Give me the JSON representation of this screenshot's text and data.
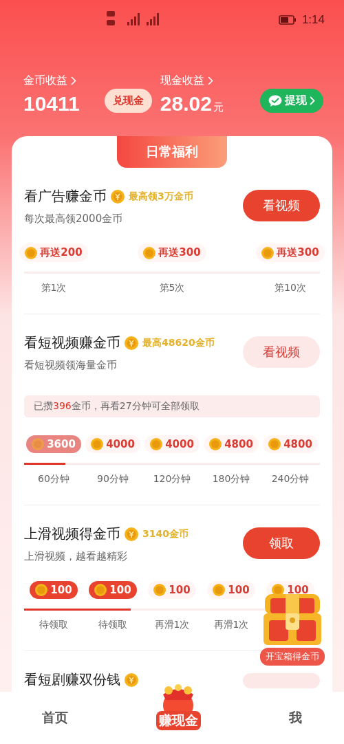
{
  "status_bar": {
    "time": "1:14"
  },
  "earnings": {
    "coins": {
      "label": "金币收益",
      "value": "10411"
    },
    "exchange_button": "兑现金",
    "cash": {
      "label": "现金收益",
      "value": "28.02",
      "unit": "元"
    },
    "withdraw_button": "提现"
  },
  "section_title": "日常福利",
  "tasks": [
    {
      "title": "看广告赚金币",
      "badge": "最高领3万金币",
      "subtitle": "每次最高领2000金币",
      "button": {
        "label": "看视频",
        "kind": "primary"
      },
      "milestones": [
        {
          "amount": "再送200",
          "caption": "第1次",
          "kind": "pending"
        },
        {
          "amount": "再送300",
          "caption": "第5次",
          "kind": "pending"
        },
        {
          "amount": "再送300",
          "caption": "第10次",
          "kind": "pending"
        }
      ]
    },
    {
      "title": "看短视频赚金币",
      "badge": "最高48620金币",
      "subtitle": "看短视频领海量金币",
      "button": {
        "label": "看视频",
        "kind": "soft"
      },
      "notice": {
        "before": "已攒",
        "highlight": "396",
        "after": "金币，再看27分钟可全部领取"
      },
      "level": 0.14,
      "milestones": [
        {
          "amount": "3600",
          "caption": "60分钟",
          "kind": "reached"
        },
        {
          "amount": "4000",
          "caption": "90分钟",
          "kind": "pending"
        },
        {
          "amount": "4000",
          "caption": "120分钟",
          "kind": "pending"
        },
        {
          "amount": "4800",
          "caption": "180分钟",
          "kind": "pending"
        },
        {
          "amount": "4800",
          "caption": "240分钟",
          "kind": "pending"
        }
      ]
    },
    {
      "title": "上滑视频得金币",
      "badge": "3140金币",
      "subtitle": "上滑视频，越看越精彩",
      "button": {
        "label": "领取",
        "kind": "primary"
      },
      "level": 0.36,
      "milestones": [
        {
          "amount": "100",
          "caption": "待领取",
          "kind": "claimable"
        },
        {
          "amount": "100",
          "caption": "待领取",
          "kind": "claimable"
        },
        {
          "amount": "100",
          "caption": "再滑1次",
          "kind": "pending"
        },
        {
          "amount": "100",
          "caption": "再滑1次",
          "kind": "pending"
        },
        {
          "amount": "100",
          "kind": "pending"
        }
      ]
    },
    {
      "title": "看短剧赚双份钱",
      "button": {
        "kind": "soft"
      }
    }
  ],
  "treasure": {
    "label": "开宝箱得金币"
  },
  "nav": [
    {
      "label": "首页",
      "kind": "text",
      "selected": false
    },
    {
      "label": "赚现金",
      "kind": "featured",
      "selected": true
    },
    {
      "label": "我",
      "kind": "text",
      "selected": false
    }
  ]
}
